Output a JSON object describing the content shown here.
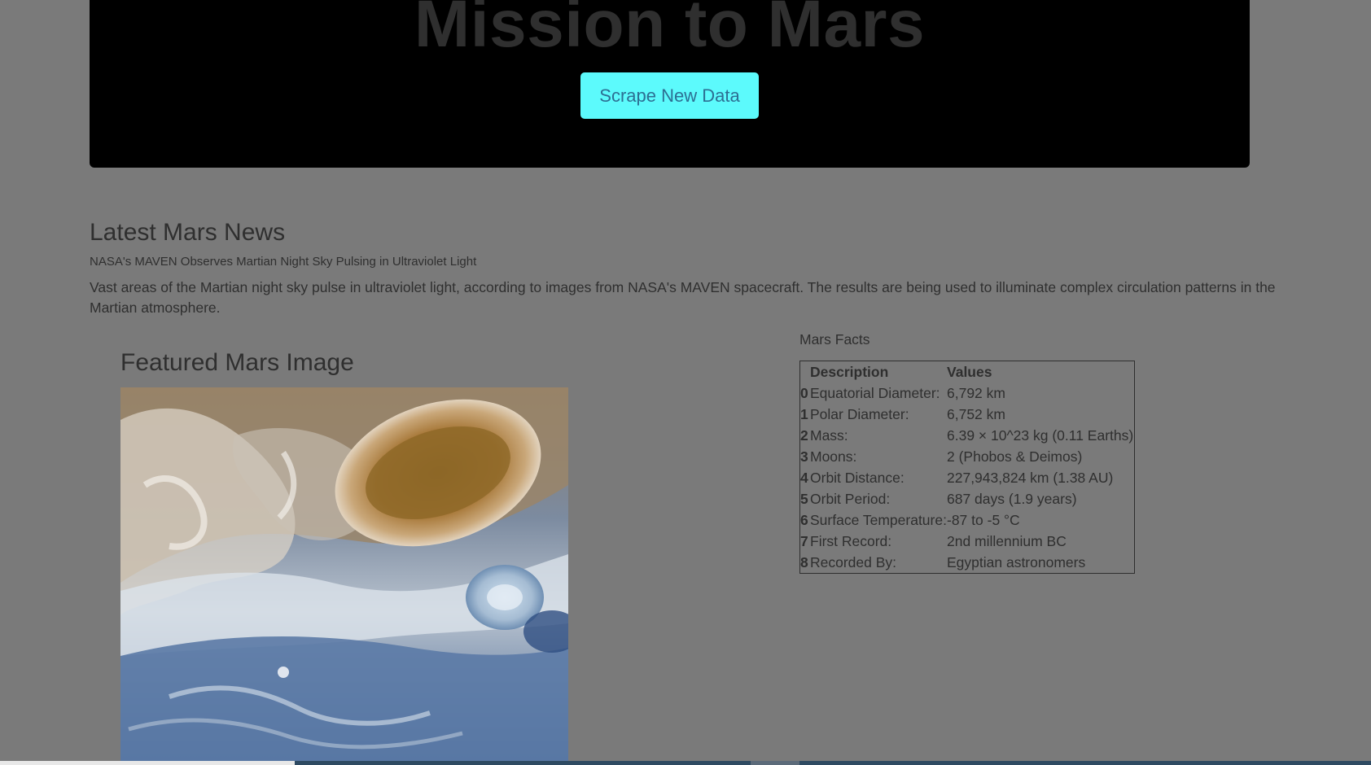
{
  "header": {
    "title": "Mission to Mars",
    "scrape_button_label": "Scrape New Data"
  },
  "news": {
    "section_title": "Latest Mars News",
    "headline": "NASA's MAVEN Observes Martian Night Sky Pulsing in Ultraviolet Light",
    "teaser": "Vast areas of the Martian night sky pulse in ultraviolet light, according to images from NASA's MAVEN spacecraft. The results are being used to illuminate complex circulation patterns in the Martian atmosphere."
  },
  "featured_image": {
    "section_title": "Featured Mars Image"
  },
  "facts": {
    "title": "Mars Facts",
    "headers": [
      "Description",
      "Values"
    ],
    "rows": [
      {
        "index": "0",
        "description": "Equatorial Diameter:",
        "value": "6,792 km"
      },
      {
        "index": "1",
        "description": "Polar Diameter:",
        "value": "6,752 km"
      },
      {
        "index": "2",
        "description": "Mass:",
        "value": "6.39 × 10^23 kg (0.11 Earths)"
      },
      {
        "index": "3",
        "description": "Moons:",
        "value": "2 (Phobos & Deimos)"
      },
      {
        "index": "4",
        "description": "Orbit Distance:",
        "value": "227,943,824 km (1.38 AU)"
      },
      {
        "index": "5",
        "description": "Orbit Period:",
        "value": "687 days (1.9 years)"
      },
      {
        "index": "6",
        "description": "Surface Temperature:",
        "value": "-87 to -5 °C"
      },
      {
        "index": "7",
        "description": "First Record:",
        "value": "2nd millennium BC"
      },
      {
        "index": "8",
        "description": "Recorded By:",
        "value": "Egyptian astronomers"
      }
    ]
  },
  "colors": {
    "page_background": "#7a7a7a",
    "jumbotron_background": "#000000",
    "button_background": "#5cfafc",
    "button_text": "#2d6f93",
    "text": "#2f2f2f"
  }
}
